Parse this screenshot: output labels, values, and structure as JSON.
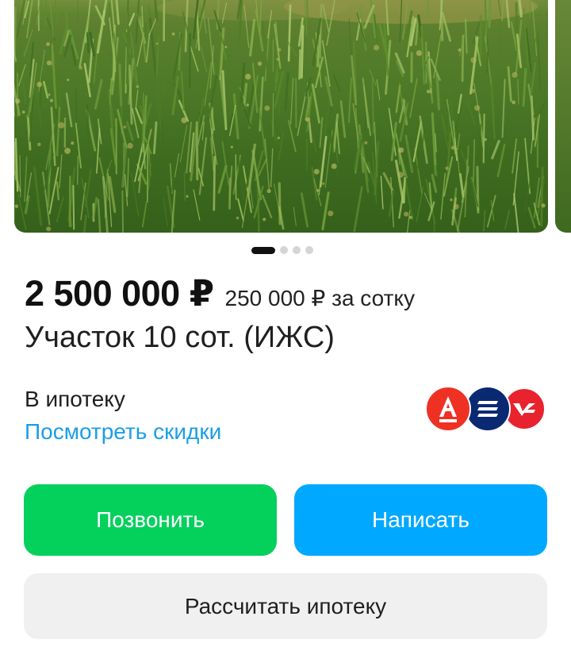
{
  "listing": {
    "price": "2 500 000 ₽",
    "price_per_unit": "250 000 ₽ за сотку",
    "title": "Участок 10 сот. (ИЖС)"
  },
  "gallery": {
    "photo_count": 4,
    "active_index": 0
  },
  "mortgage": {
    "label": "В ипотеку",
    "discount_link": "Посмотреть скидки",
    "banks": [
      {
        "name": "alfa-bank-logo",
        "color": "#ef3124"
      },
      {
        "name": "vtb-logo",
        "color": "#0a2973"
      },
      {
        "name": "psb-logo",
        "color": "#e8232e"
      }
    ]
  },
  "actions": {
    "call": "Позвонить",
    "write": "Написать",
    "calc_mortgage": "Рассчитать ипотеку"
  },
  "colors": {
    "call_button": "#04d05c",
    "write_button": "#00a8ff",
    "link": "#1a9ee6",
    "secondary_button": "#f0f0f0"
  }
}
